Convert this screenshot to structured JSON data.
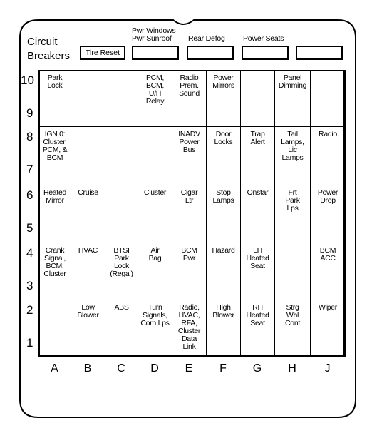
{
  "header": {
    "line1": "Circuit",
    "line2": "Breakers"
  },
  "top_boxes": [
    {
      "label": "",
      "text": "Tire Reset"
    },
    {
      "label": "Pwr Windows\nPwr Sunroof",
      "text": ""
    },
    {
      "label": "Rear Defog",
      "text": ""
    },
    {
      "label": "Power Seats",
      "text": ""
    },
    {
      "label": "",
      "text": ""
    }
  ],
  "columns": [
    "A",
    "B",
    "C",
    "D",
    "E",
    "F",
    "G",
    "H",
    "J"
  ],
  "row_labels": [
    [
      "10",
      "9"
    ],
    [
      "8",
      "7"
    ],
    [
      "6",
      "5"
    ],
    [
      "4",
      "3"
    ],
    [
      "2",
      "1"
    ]
  ],
  "rows": [
    [
      "Park\nLock",
      "",
      "",
      "PCM,\nBCM,\nU/H\nRelay",
      "Radio\nPrem.\nSound",
      "Power\nMirrors",
      "",
      "Panel\nDimming",
      ""
    ],
    [
      "IGN 0:\nCluster,\nPCM, &\nBCM",
      "",
      "",
      "",
      "INADV\nPower\nBus",
      "Door\nLocks",
      "Trap\nAlert",
      "Tail\nLamps,\nLic\nLamps",
      "Radio"
    ],
    [
      "Heated\nMirror",
      "Cruise",
      "",
      "Cluster",
      "Cigar\nLtr",
      "Stop\nLamps",
      "Onstar",
      "Frt\nPark\nLps",
      "Power\nDrop"
    ],
    [
      "Crank\nSignal,\nBCM,\nCluster",
      "HVAC",
      "BTSI\nPark\nLock\n(Regal)",
      "Air\nBag",
      "BCM\nPwr",
      "Hazard",
      "LH\nHeated\nSeat",
      "",
      "BCM\nACC"
    ],
    [
      "",
      "Low\nBlower",
      "ABS",
      "Turn\nSignals,\nCorn Lps",
      "Radio,\nHVAC,\nRFA,\nCluster\nData\nLink",
      "High\nBlower",
      "RH\nHeated\nSeat",
      "Strg\nWhl\nCont",
      "Wiper"
    ]
  ]
}
